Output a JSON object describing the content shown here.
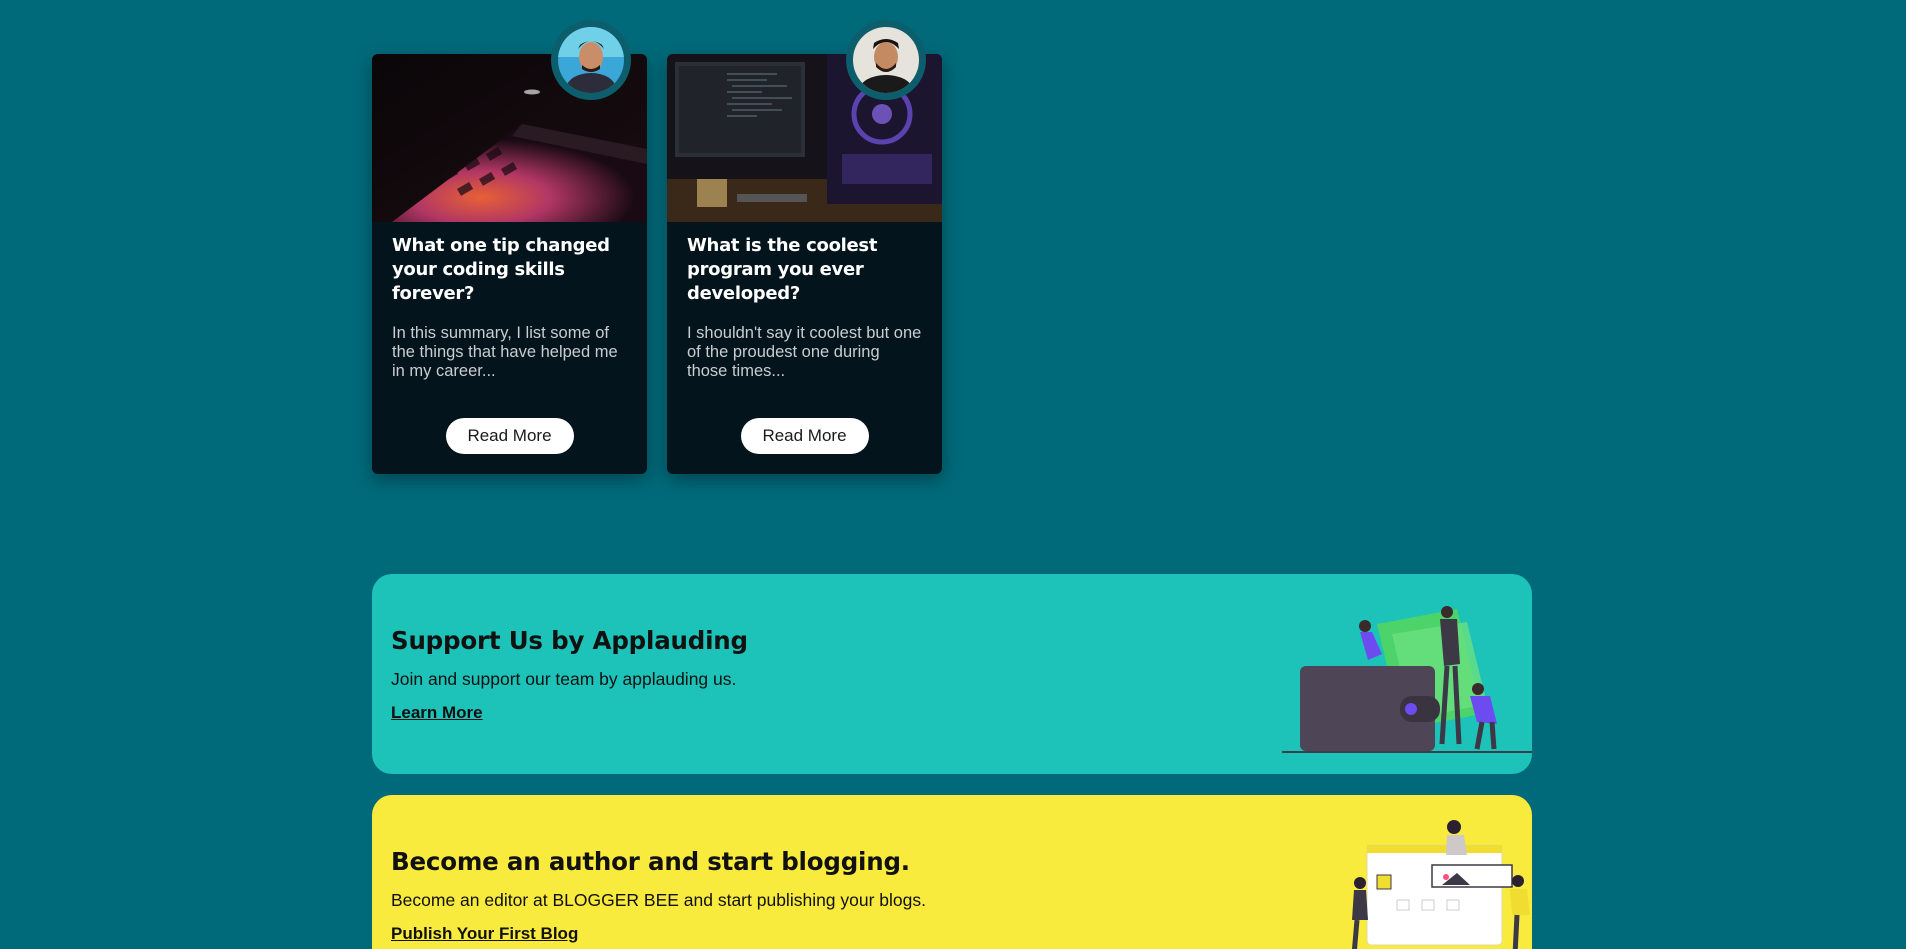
{
  "cards": [
    {
      "title": "What one tip changed your coding skills forever?",
      "excerpt": "In this summary, I list some of the things that have helped me in my career...",
      "button_label": "Read More",
      "image_icon": "laptop-photo",
      "avatar_icon": "author-avatar"
    },
    {
      "title": "What is the coolest program you ever developed?",
      "excerpt": "I shouldn't say it coolest but one of the proudest one during those times...",
      "button_label": "Read More",
      "image_icon": "desk-setup-photo",
      "avatar_icon": "author-avatar"
    }
  ],
  "support_banner": {
    "title": "Support Us by Applauding",
    "description": "Join and support our team by applauding us.",
    "link_label": "Learn More",
    "background": "#1dc2b8",
    "illustration_icon": "wallet-people-illustration"
  },
  "author_banner": {
    "title": "Become an author and start blogging.",
    "description": "Become an editor at BLOGGER BEE and start publishing your blogs.",
    "link_label": "Publish Your First Blog",
    "background": "#f8eb3e",
    "illustration_icon": "blog-editing-illustration"
  },
  "colors": {
    "page_background": "#006a7a",
    "card_background": "#03141c"
  }
}
